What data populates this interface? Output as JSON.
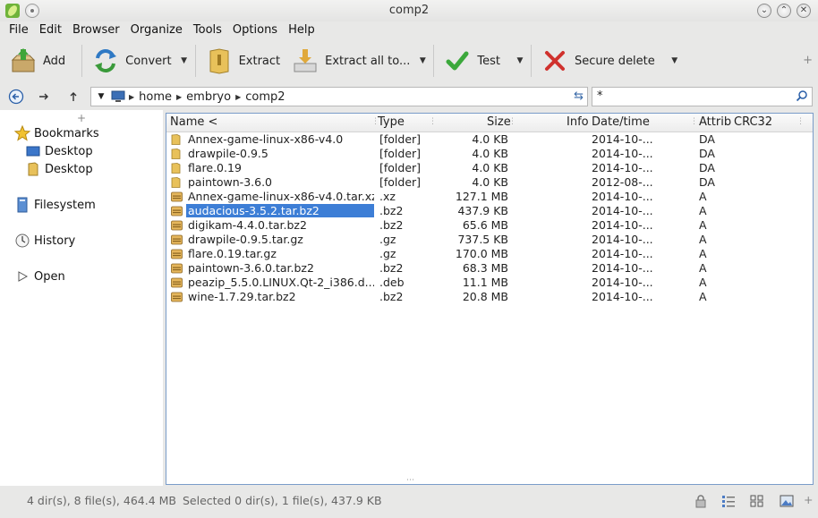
{
  "window": {
    "title": "comp2"
  },
  "menu": [
    "File",
    "Edit",
    "Browser",
    "Organize",
    "Tools",
    "Options",
    "Help"
  ],
  "toolbar": {
    "add": "Add",
    "convert": "Convert",
    "extract": "Extract",
    "extract_all": "Extract all to...",
    "test": "Test",
    "secure_delete": "Secure delete"
  },
  "address": {
    "crumbs": [
      "home",
      "embryo",
      "comp2"
    ],
    "filter_value": "*"
  },
  "sidebar": {
    "bookmarks": "Bookmarks",
    "desktop1": "Desktop",
    "desktop2": "Desktop",
    "filesystem": "Filesystem",
    "history": "History",
    "open": "Open"
  },
  "columns": {
    "name": "Name <",
    "type": "Type",
    "size": "Size",
    "info": "Info",
    "date": "Date/time",
    "attrib": "Attrib",
    "crc": "CRC32"
  },
  "files": [
    {
      "name": "Annex-game-linux-x86-v4.0",
      "type": "[folder]",
      "size": "4.0 KB",
      "date": "2014-10-...",
      "attr": "DA",
      "kind": "folder"
    },
    {
      "name": "drawpile-0.9.5",
      "type": "[folder]",
      "size": "4.0 KB",
      "date": "2014-10-...",
      "attr": "DA",
      "kind": "folder"
    },
    {
      "name": "flare.0.19",
      "type": "[folder]",
      "size": "4.0 KB",
      "date": "2014-10-...",
      "attr": "DA",
      "kind": "folder"
    },
    {
      "name": "paintown-3.6.0",
      "type": "[folder]",
      "size": "4.0 KB",
      "date": "2012-08-...",
      "attr": "DA",
      "kind": "folder"
    },
    {
      "name": "Annex-game-linux-x86-v4.0.tar.xz",
      "type": ".xz",
      "size": "127.1 MB",
      "date": "2014-10-...",
      "attr": "A",
      "kind": "archive"
    },
    {
      "name": "audacious-3.5.2.tar.bz2",
      "type": ".bz2",
      "size": "437.9 KB",
      "date": "2014-10-...",
      "attr": "A",
      "kind": "archive",
      "selected": true
    },
    {
      "name": "digikam-4.4.0.tar.bz2",
      "type": ".bz2",
      "size": "65.6 MB",
      "date": "2014-10-...",
      "attr": "A",
      "kind": "archive"
    },
    {
      "name": "drawpile-0.9.5.tar.gz",
      "type": ".gz",
      "size": "737.5 KB",
      "date": "2014-10-...",
      "attr": "A",
      "kind": "archive"
    },
    {
      "name": "flare.0.19.tar.gz",
      "type": ".gz",
      "size": "170.0 MB",
      "date": "2014-10-...",
      "attr": "A",
      "kind": "archive"
    },
    {
      "name": "paintown-3.6.0.tar.bz2",
      "type": ".bz2",
      "size": "68.3 MB",
      "date": "2014-10-...",
      "attr": "A",
      "kind": "archive"
    },
    {
      "name": "peazip_5.5.0.LINUX.Qt-2_i386.d...",
      "type": ".deb",
      "size": "11.1 MB",
      "date": "2014-10-...",
      "attr": "A",
      "kind": "archive"
    },
    {
      "name": "wine-1.7.29.tar.bz2",
      "type": ".bz2",
      "size": "20.8 MB",
      "date": "2014-10-...",
      "attr": "A",
      "kind": "archive"
    }
  ],
  "status": {
    "totals": "4 dir(s), 8 file(s), 464.4 MB",
    "selection": "Selected 0 dir(s), 1 file(s), 437.9 KB"
  }
}
